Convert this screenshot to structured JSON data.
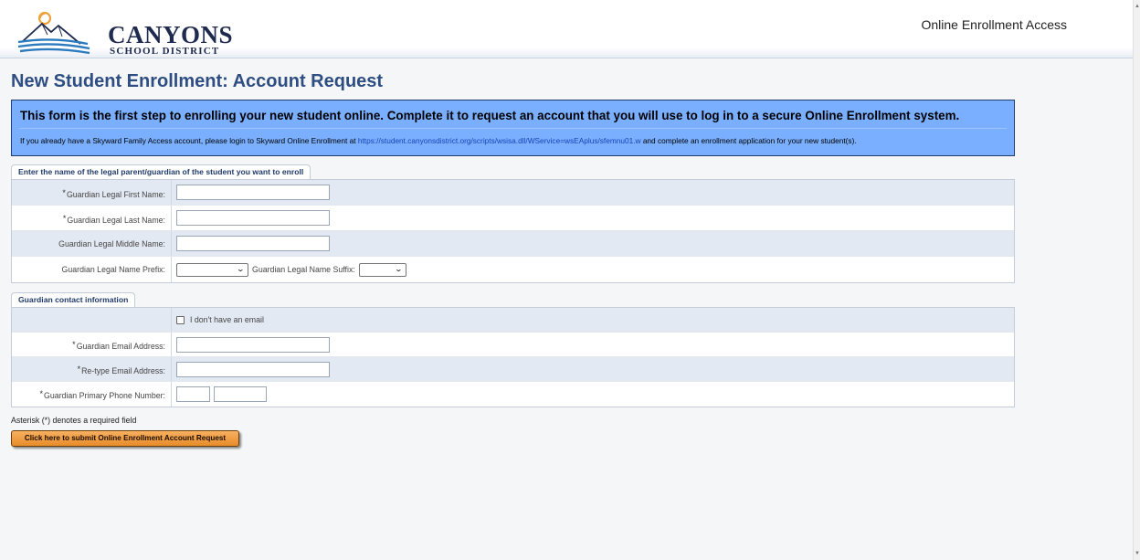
{
  "header": {
    "logo_name": "CANYONS",
    "logo_sub": "SCHOOL DISTRICT",
    "right_title": "Online Enrollment Access"
  },
  "page_title": "New Student Enrollment: Account Request",
  "info": {
    "headline": "This form is the first step to enrolling your new student online. Complete it to request an account that you will use to log in to a secure Online Enrollment system.",
    "text_before": "If you already have a Skyward Family Access account, please login to Skyward Online Enrollment at ",
    "link": "https://student.canyonsdistrict.org/scripts/wsisa.dll/WService=wsEAplus/sfemnu01.w",
    "text_after": " and complete an enrollment application for your new student(s)."
  },
  "guardian_section": {
    "tab": "Enter the name of the legal parent/guardian of the student you want to enroll",
    "first_name_label": "Guardian Legal First Name:",
    "first_name_value": "",
    "last_name_label": "Guardian Legal Last Name:",
    "last_name_value": "",
    "middle_name_label": "Guardian Legal Middle Name:",
    "middle_name_value": "",
    "prefix_label": "Guardian Legal Name Prefix:",
    "prefix_value": "",
    "suffix_label": "Guardian Legal Name Suffix:",
    "suffix_value": ""
  },
  "contact_section": {
    "tab": "Guardian contact information",
    "no_email_label": "I don't have an email",
    "email_label": "Guardian Email Address:",
    "email_value": "",
    "retype_label": "Re-type Email Address:",
    "retype_value": "",
    "phone_label": "Guardian Primary Phone Number:",
    "phone_area": "",
    "phone_number": ""
  },
  "required_marker": "*",
  "footnote": "Asterisk (*) denotes a required field",
  "submit_label": "Click here to submit Online Enrollment Account Request",
  "colors": {
    "title": "#2e4e83",
    "info_bg": "#7aafff",
    "button": "#e88c2a"
  }
}
